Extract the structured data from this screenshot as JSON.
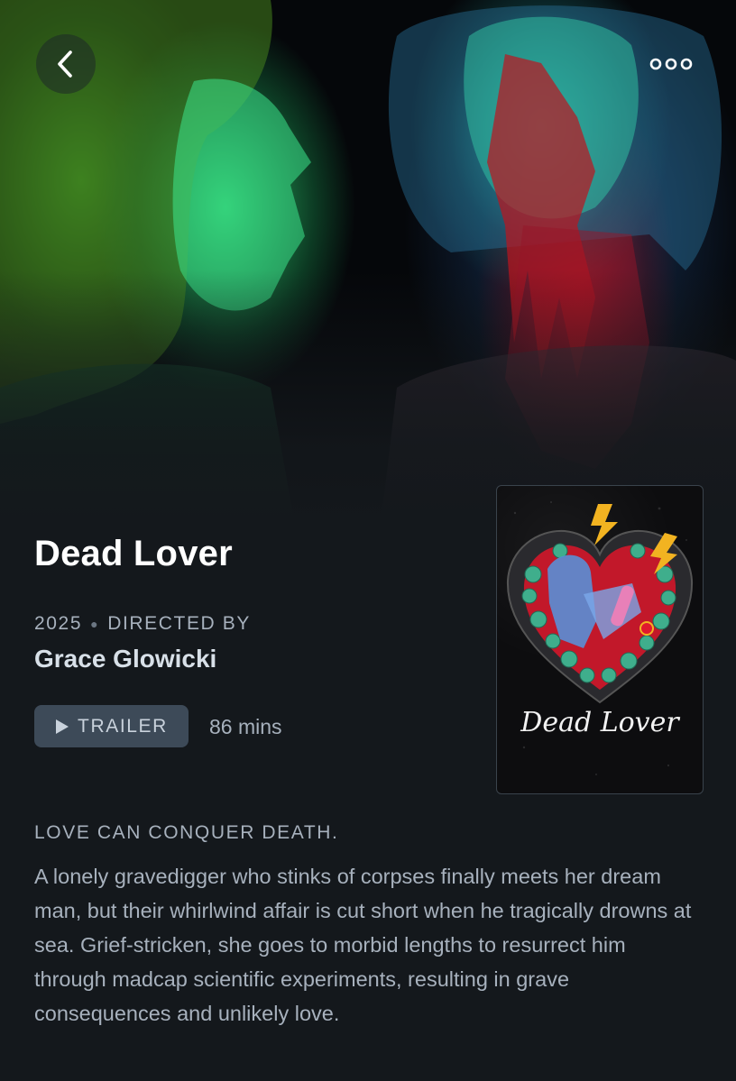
{
  "header": {
    "back_icon": "chevron-left-icon",
    "more_icon": "more-horizontal-icon"
  },
  "film": {
    "title": "Dead Lover",
    "year": "2025",
    "directed_by_label": "DIRECTED BY",
    "director": "Grace Glowicki",
    "trailer_label": "TRAILER",
    "runtime": "86 mins",
    "tagline": "LOVE CAN CONQUER DEATH.",
    "synopsis": "A lonely gravedigger who stinks of corpses finally meets her dream man, but their whirlwind affair is cut short when he tragically drowns at sea. Grief-stricken, she goes to morbid lengths to resurrect him through madcap scientific experiments, resulting in grave consequences and unlikely love."
  },
  "poster": {
    "title_text": "Dead Lover"
  },
  "colors": {
    "background": "#14181c",
    "title": "#ffffff",
    "muted_text": "#a7b1bd",
    "director": "#d8e0e8",
    "trailer_button": "#3d4a58"
  }
}
